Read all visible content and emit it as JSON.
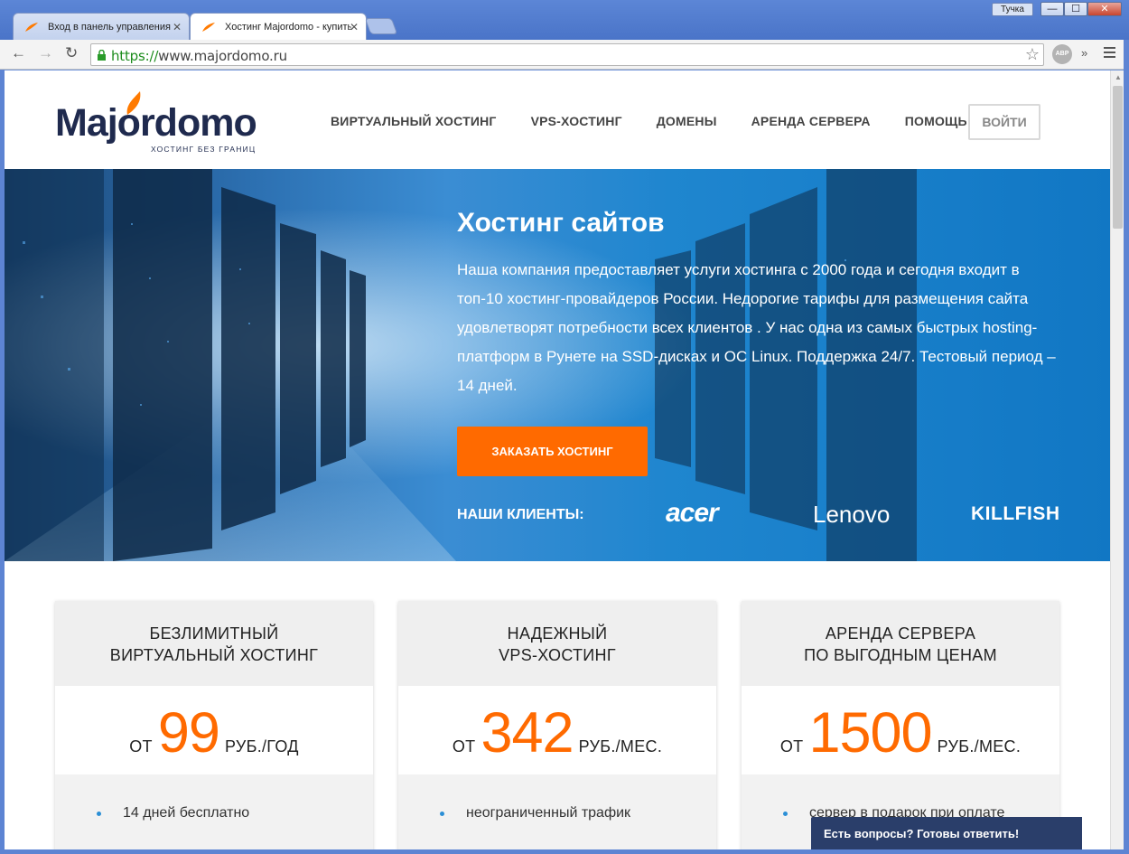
{
  "browser": {
    "tabs": [
      {
        "title": "Вход в панель управления",
        "close": "✕"
      },
      {
        "title": "Хостинг Majordomo - купить",
        "close": "✕"
      }
    ],
    "user_button": "Тучка",
    "window_controls": {
      "minimize": "—",
      "maximize": "☐",
      "close": "✕"
    },
    "url_protocol": "https://",
    "url_rest": "www.majordomo.ru",
    "abp": "ABP",
    "more": "»"
  },
  "site": {
    "logo_word": "Majordomo",
    "logo_tagline": "ХОСТИНГ БЕЗ ГРАНИЦ",
    "nav": [
      "ВИРТУАЛЬНЫЙ ХОСТИНГ",
      "VPS-ХОСТИНГ",
      "ДОМЕНЫ",
      "АРЕНДА СЕРВЕРА",
      "ПОМОЩЬ"
    ],
    "login": "ВОЙТИ"
  },
  "hero": {
    "title": "Хостинг сайтов",
    "text": "Наша компания предоставляет услуги хостинга с 2000 года и сегодня входит в топ-10 хостинг-провайдеров России. Недорогие тарифы для размещения сайта удовлетворят потребности всех клиентов . У нас одна из самых быстрых hosting-платформ в Рунете на SSD-дисках и ОС Linux. Поддержка 24/7. Тестовый период – 14 дней.",
    "cta": "ЗАКАЗАТЬ ХОСТИНГ",
    "clients_label": "НАШИ КЛИЕНТЫ:",
    "clients": [
      "acer",
      "Lenovo",
      "KILLFISH"
    ]
  },
  "cards": [
    {
      "line1": "БЕЗЛИМИТНЫЙ",
      "line2": "ВИРТУАЛЬНЫЙ ХОСТИНГ",
      "ot": "ОТ",
      "price": "99",
      "unit": "РУБ./ГОД",
      "feature": "14 дней бесплатно"
    },
    {
      "line1": "НАДЕЖНЫЙ",
      "line2": "VPS-ХОСТИНГ",
      "ot": "ОТ",
      "price": "342",
      "unit": "РУБ./МЕС.",
      "feature": "неограниченный трафик"
    },
    {
      "line1": "АРЕНДА СЕРВЕРА",
      "line2": "ПО ВЫГОДНЫМ ЦЕНАМ",
      "ot": "ОТ",
      "price": "1500",
      "unit": "РУБ./МЕС.",
      "feature": "сервер в подарок при оплате"
    }
  ],
  "chat": "Есть вопросы? Готовы ответить!",
  "colors": {
    "accent": "#ff6a00",
    "brand": "#1f2a4e",
    "hero": "#1f86cf",
    "chat": "#2a3e6a"
  }
}
